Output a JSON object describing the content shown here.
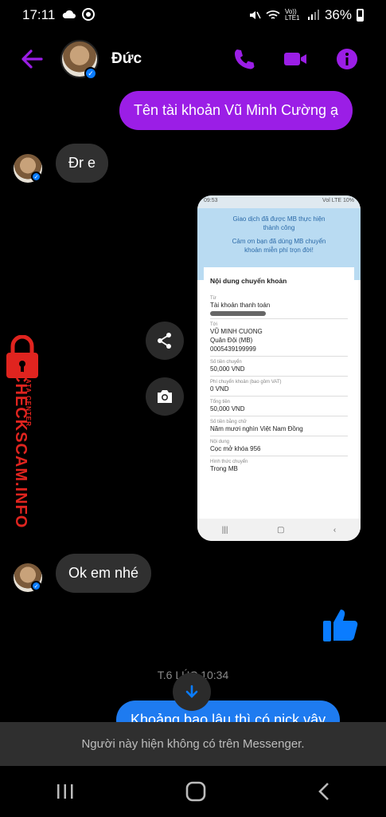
{
  "status_bar": {
    "time": "17:11",
    "network": "Vo)) LTE1",
    "battery": "36%"
  },
  "header": {
    "name": "Đức",
    "accent_color": "#9b1ee6"
  },
  "messages": {
    "m1": "Tên tài khoản Vũ Minh Cường ạ",
    "m2": "Đr e",
    "m3": "Ok em nhé",
    "m4": "Khoảng bao lâu thì có nick vậy"
  },
  "screenshot": {
    "status_time": "09:53",
    "status_right": "Vol LTE 10%",
    "headline_1": "Giao dịch đã được MB thực hiện",
    "headline_2": "thành công",
    "thanks_1": "Cảm ơn bạn đã dùng MB chuyển",
    "thanks_2": "khoản miễn phí trọn đời!",
    "section_title": "Nội dung chuyển khoản",
    "rows": [
      {
        "label": "Từ",
        "value": "Tài khoản thanh toán",
        "value2": ""
      },
      {
        "label": "Tới",
        "value": "VŨ MINH CUONG",
        "value2": "Quân Đội (MB)",
        "value3": "0005439199999"
      },
      {
        "label": "Số tiền chuyển",
        "value": "50,000 VND"
      },
      {
        "label": "Phí chuyển khoản (bao gồm VAT)",
        "value": "0 VND"
      },
      {
        "label": "Tổng tiền",
        "value": "50,000 VND"
      },
      {
        "label": "Số tiền bằng chữ",
        "value": "Năm mươi nghìn Việt Nam Đồng"
      },
      {
        "label": "Nội dung",
        "value": "Cọc mở khóa 956"
      },
      {
        "label": "Hình thức chuyển",
        "value": "Trong MB"
      }
    ]
  },
  "watermark": {
    "brand": "CHECKSCAM.INFO",
    "sub": "DATA CENTER"
  },
  "timestamp": "T.6 LÚC 10:34",
  "notice": "Người này hiện không có trên Messenger."
}
